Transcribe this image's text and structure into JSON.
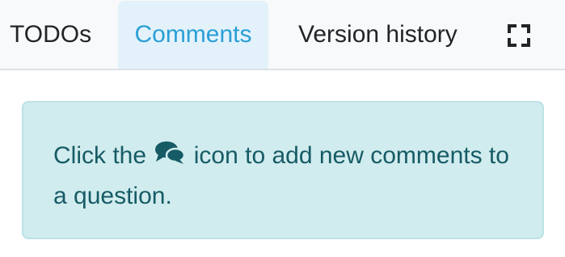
{
  "tabs": [
    {
      "label": "TODOs",
      "active": false
    },
    {
      "label": "Comments",
      "active": true
    },
    {
      "label": "Version history",
      "active": false
    }
  ],
  "toolbar": {
    "fullscreen_icon": "expand-icon"
  },
  "alert": {
    "text_before": "Click the",
    "icon": "comments-icon",
    "text_after": "icon to add new comments to a question."
  },
  "colors": {
    "active_tab_text": "#2a9fd6",
    "active_tab_bg": "#e3f2fa",
    "alert_bg": "#d1ecee",
    "alert_text": "#165b66"
  }
}
